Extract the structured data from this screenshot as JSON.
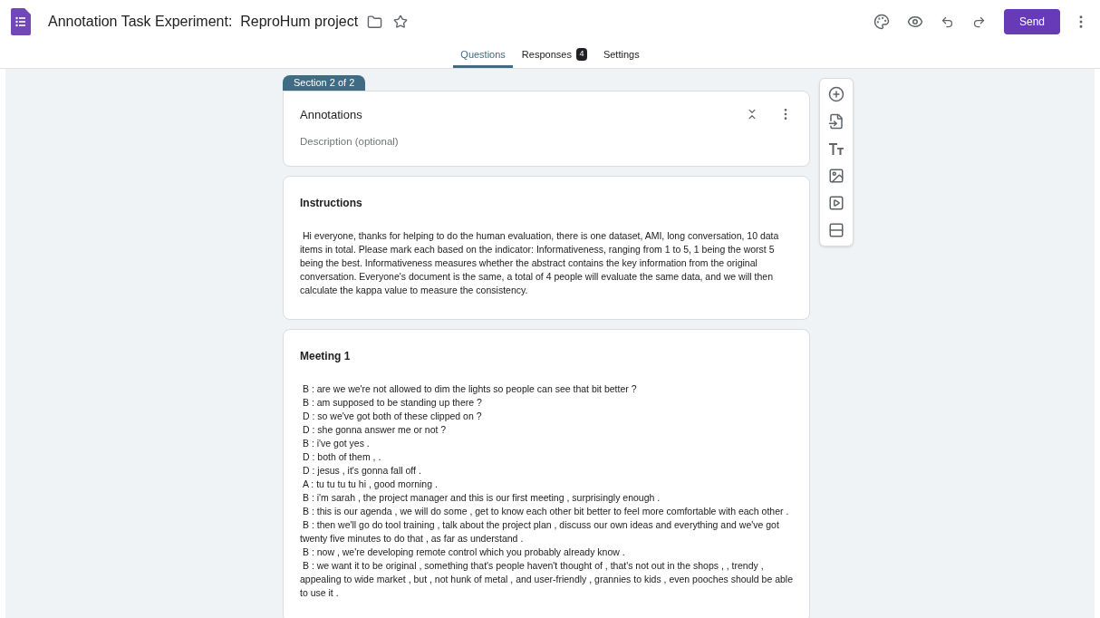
{
  "header": {
    "title": "Annotation Task Experiment:  ReproHum project",
    "send_button": "Send"
  },
  "tabs": [
    {
      "label": "Questions",
      "selected": true
    },
    {
      "label": "Responses",
      "selected": false,
      "badge": "4"
    },
    {
      "label": "Settings",
      "selected": false
    }
  ],
  "section": {
    "badge": "Section 2 of 2",
    "title": "Annotations",
    "description_placeholder": "Description (optional)"
  },
  "cards": [
    {
      "title": "Instructions",
      "paragraphs": [
        "Hi everyone, thanks for helping to do the human evaluation, there is one dataset, AMI, long conversation, 10 data items in total. Please mark each based on the indicator: Informativeness, ranging from 1 to 5, 1 being the worst 5 being the best. Informativeness measures whether the abstract contains the key information from the original conversation.  Everyone's document is the same, a total of 4 people will evaluate the same data, and we will then calculate the kappa value to measure the consistency."
      ]
    },
    {
      "title": "Meeting 1",
      "paragraphs": [
        "B : are we we're not allowed to dim the lights so people can see that bit better ?",
        "B : am supposed to be standing up there ?",
        "D : so we've got both of these clipped on ?",
        "D : she gonna answer me or not ?",
        "B : i've got yes .",
        "D : both of them , .",
        "D : jesus , it's gonna fall off .",
        "A : tu tu tu tu hi , good morning .",
        "B : i'm sarah , the project manager and this is our first meeting , surprisingly enough .",
        "B : this is our agenda , we will do some , get to know each other bit better to feel more comfortable with each other .",
        "B : then we'll go do tool training , talk about the project plan , discuss our own ideas and everything and we've got twenty five minutes to do that , as far as understand .",
        "B : now , we're developing remote control which you probably already know .",
        "B : we want it to be original , something that's people haven't thought of , that's not out in the shops , , trendy , appealing to wide market , but , not hunk of metal , and user-friendly , grannies to kids , even pooches should be able to use it ."
      ]
    }
  ]
}
